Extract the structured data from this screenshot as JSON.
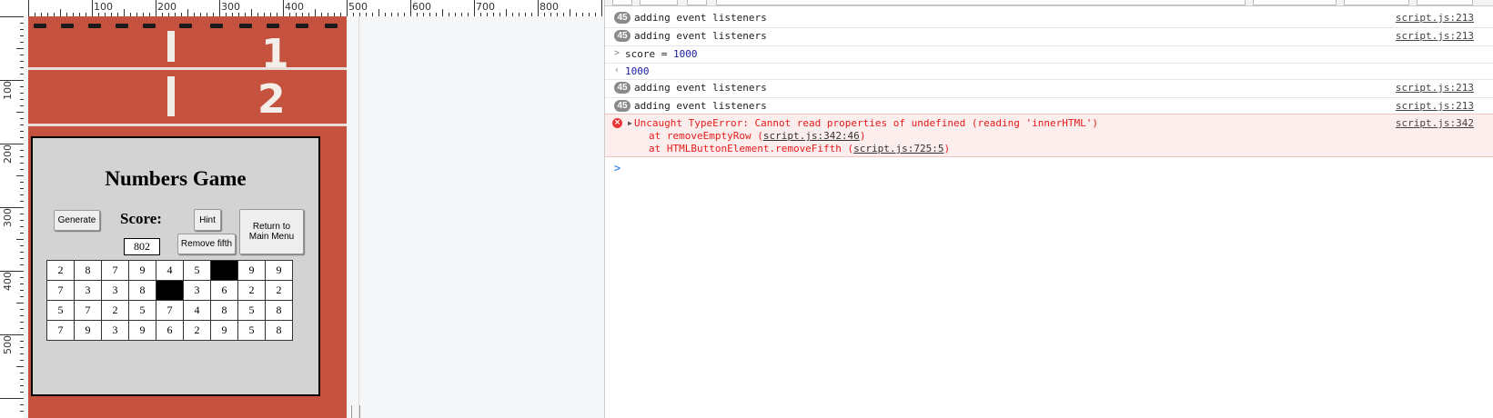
{
  "ruler": {
    "horizontal_labels": [
      "100",
      "200",
      "300",
      "400",
      "500",
      "600",
      "700",
      "800"
    ],
    "vertical_labels": [
      "100",
      "200",
      "300",
      "400",
      "500"
    ]
  },
  "game": {
    "title": "Numbers Game",
    "generate_label": "Generate",
    "score_label": "Score:",
    "score_value": "802",
    "hint_label": "Hint",
    "remove_fifth_label": "Remove fifth",
    "return_label": "Return to Main Menu",
    "lanes": [
      "1",
      "2"
    ],
    "grid": [
      [
        "2",
        "8",
        "7",
        "9",
        "4",
        "5",
        "",
        "9",
        "9"
      ],
      [
        "7",
        "3",
        "3",
        "8",
        "",
        "3",
        "6",
        "2",
        "2"
      ],
      [
        "5",
        "7",
        "2",
        "5",
        "7",
        "4",
        "8",
        "5",
        "8"
      ],
      [
        "7",
        "9",
        "3",
        "9",
        "6",
        "2",
        "9",
        "5",
        "8"
      ]
    ]
  },
  "console": {
    "rows": [
      {
        "kind": "log",
        "badge": "45",
        "message": "adding event listeners",
        "source": "script.js:213"
      },
      {
        "kind": "log",
        "badge": "45",
        "message": "adding event listeners",
        "source": "script.js:213"
      },
      {
        "kind": "input",
        "message_prefix": "score = ",
        "message_number": "1000"
      },
      {
        "kind": "result",
        "message": "1000"
      },
      {
        "kind": "log",
        "badge": "45",
        "message": "adding event listeners",
        "source": "script.js:213"
      },
      {
        "kind": "log",
        "badge": "45",
        "message": "adding event listeners",
        "source": "script.js:213"
      }
    ],
    "error": {
      "message": "Uncaught TypeError: Cannot read properties of undefined (reading 'innerHTML')",
      "source": "script.js:342",
      "stack": [
        {
          "prefix": "at removeEmptyRow (",
          "link": "script.js:342:46",
          "suffix": ")"
        },
        {
          "prefix": "at HTMLButtonElement.removeFifth (",
          "link": "script.js:725:5",
          "suffix": ")"
        }
      ]
    }
  },
  "colors": {
    "track": "#c4523f",
    "panel": "#d3d3d3",
    "error_text": "#e41b1b",
    "error_bg": "#fdeeee",
    "badge": "#8a8a8a"
  }
}
